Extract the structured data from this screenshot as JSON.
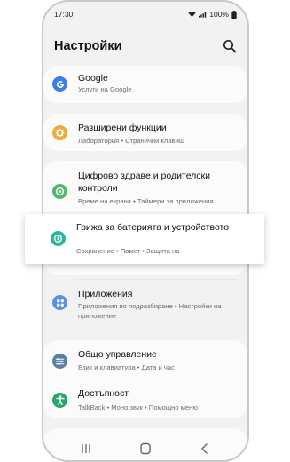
{
  "status": {
    "time": "17:30",
    "battery": "100%"
  },
  "header": {
    "title": "Настройки"
  },
  "items": [
    {
      "title": "Google",
      "subtitle": "Услуги на Google",
      "color": "#3d7ee8",
      "icon": "google-icon"
    },
    {
      "title": "Разширени функции",
      "subtitle": "Лаборатория • Странични клавиш",
      "color": "#f0a93b",
      "icon": "gear-plus-icon"
    },
    {
      "title": "Цифрово здраве и родителски контроли",
      "subtitle": "Време на екрана • Таймери за приложения",
      "color": "#4fb86a",
      "icon": "digital-wellbeing-icon"
    },
    {
      "title": "Приложения",
      "subtitle": "Приложения по подразбиране • Настройки на приложение",
      "color": "#5b8fe8",
      "icon": "apps-grid-icon"
    },
    {
      "title": "Общо управление",
      "subtitle": "Език и клавиатура • Дата и час",
      "color": "#5a7fa8",
      "icon": "sliders-icon"
    },
    {
      "title": "Достъпност",
      "subtitle": "TalkBack • Моно звук • Помощно меню",
      "color": "#2aa66a",
      "icon": "accessibility-icon"
    }
  ],
  "highlight": {
    "title": "Грижа за батерията и устройството",
    "subtitle": "Сохранение • Памет • Защита на",
    "color": "#2bb5a0",
    "icon": "device-care-icon"
  },
  "nav": {
    "recents_icon": "recents-icon",
    "home_icon": "home-icon",
    "back_icon": "back-icon"
  }
}
